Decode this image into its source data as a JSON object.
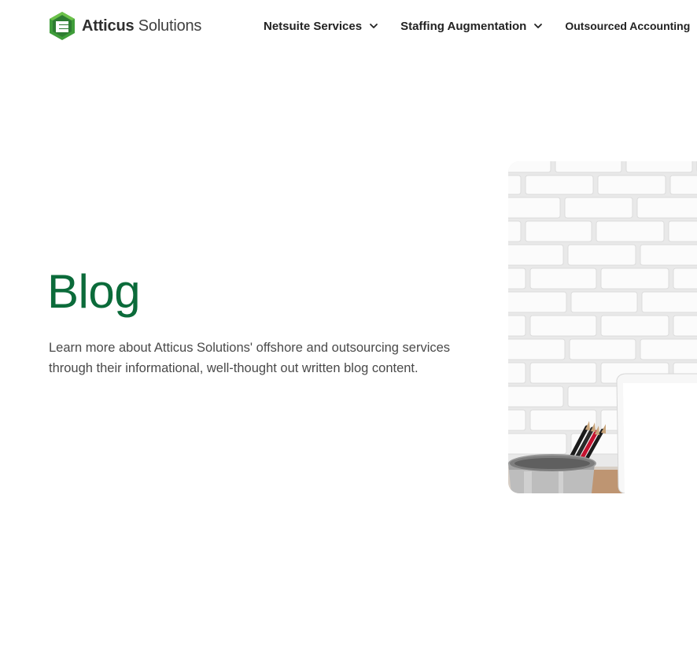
{
  "header": {
    "logo": {
      "brand_bold": "Atticus",
      "brand_light": "Solutions",
      "mark_icon": "atticus-hexagon-logo-icon",
      "mark_color": "#3f9d3a"
    },
    "nav": {
      "items": [
        {
          "label": "Netsuite Services",
          "icon": "chevron-down-icon"
        },
        {
          "label": "Staffing Augmentation",
          "icon": "chevron-down-icon"
        },
        {
          "label": "Outsourced Accounting"
        }
      ]
    }
  },
  "hero": {
    "title": "Blog",
    "description": "Learn more about Atticus Solutions' offshore and outsourcing services through their informational, well-thought out written blog content.",
    "title_color": "#0b6b3a",
    "image_icon": "office-desk-photo"
  }
}
